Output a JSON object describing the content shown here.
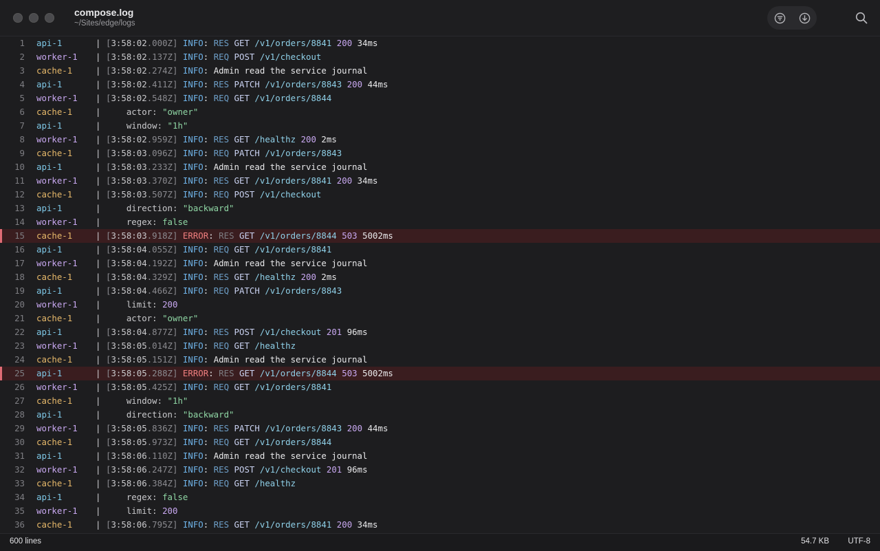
{
  "window": {
    "title": "compose.log",
    "path": "~/Sites/edge/logs"
  },
  "toolbar": {
    "icons": [
      "filter-icon",
      "download-icon",
      "search-icon"
    ]
  },
  "colors": {
    "background": "#1d1d1f",
    "error_row": "#3a1d1f",
    "api": "#7ec7e6",
    "worker": "#c8a8f0",
    "cache": "#e6b86a",
    "info": "#6fb3e8",
    "error": "#f07f7f"
  },
  "log_lines": [
    {
      "n": "1",
      "service": "api-1",
      "ts_prefix": "3:58:02",
      "ts_suffix": ".000Z",
      "level": "INFO",
      "dir": "RES",
      "method": "GET",
      "path": "/v1/orders/8841",
      "status": "200",
      "dur": "34ms"
    },
    {
      "n": "2",
      "service": "worker-1",
      "ts_prefix": "3:58:02",
      "ts_suffix": ".137Z",
      "level": "INFO",
      "dir": "REQ",
      "method": "POST",
      "path": "/v1/checkout"
    },
    {
      "n": "3",
      "service": "cache-1",
      "ts_prefix": "3:58:02",
      "ts_suffix": ".274Z",
      "level": "INFO",
      "text": "Admin read the service journal"
    },
    {
      "n": "4",
      "service": "api-1",
      "ts_prefix": "3:58:02",
      "ts_suffix": ".411Z",
      "level": "INFO",
      "dir": "RES",
      "method": "PATCH",
      "path": "/v1/orders/8843",
      "status": "200",
      "dur": "44ms"
    },
    {
      "n": "5",
      "service": "worker-1",
      "ts_prefix": "3:58:02",
      "ts_suffix": ".548Z",
      "level": "INFO",
      "dir": "REQ",
      "method": "GET",
      "path": "/v1/orders/8844"
    },
    {
      "n": "6",
      "service": "cache-1",
      "key": "actor",
      "value": "\"owner\"",
      "vtype": "str"
    },
    {
      "n": "7",
      "service": "api-1",
      "key": "window",
      "value": "\"1h\"",
      "vtype": "str"
    },
    {
      "n": "8",
      "service": "worker-1",
      "ts_prefix": "3:58:02",
      "ts_suffix": ".959Z",
      "level": "INFO",
      "dir": "RES",
      "method": "GET",
      "path": "/healthz",
      "status": "200",
      "dur": "2ms"
    },
    {
      "n": "9",
      "service": "cache-1",
      "ts_prefix": "3:58:03",
      "ts_suffix": ".096Z",
      "level": "INFO",
      "dir": "REQ",
      "method": "PATCH",
      "path": "/v1/orders/8843"
    },
    {
      "n": "10",
      "service": "api-1",
      "ts_prefix": "3:58:03",
      "ts_suffix": ".233Z",
      "level": "INFO",
      "text": "Admin read the service journal"
    },
    {
      "n": "11",
      "service": "worker-1",
      "ts_prefix": "3:58:03",
      "ts_suffix": ".370Z",
      "level": "INFO",
      "dir": "RES",
      "method": "GET",
      "path": "/v1/orders/8841",
      "status": "200",
      "dur": "34ms"
    },
    {
      "n": "12",
      "service": "cache-1",
      "ts_prefix": "3:58:03",
      "ts_suffix": ".507Z",
      "level": "INFO",
      "dir": "REQ",
      "method": "POST",
      "path": "/v1/checkout"
    },
    {
      "n": "13",
      "service": "api-1",
      "key": "direction",
      "value": "\"backward\"",
      "vtype": "str"
    },
    {
      "n": "14",
      "service": "worker-1",
      "key": "regex",
      "value": "false",
      "vtype": "bool"
    },
    {
      "n": "15",
      "service": "cache-1",
      "ts_prefix": "3:58:03",
      "ts_suffix": ".918Z",
      "level": "ERROR",
      "dir": "RES",
      "method": "GET",
      "path": "/v1/orders/8844",
      "status": "503",
      "dur": "5002ms"
    },
    {
      "n": "16",
      "service": "api-1",
      "ts_prefix": "3:58:04",
      "ts_suffix": ".055Z",
      "level": "INFO",
      "dir": "REQ",
      "method": "GET",
      "path": "/v1/orders/8841"
    },
    {
      "n": "17",
      "service": "worker-1",
      "ts_prefix": "3:58:04",
      "ts_suffix": ".192Z",
      "level": "INFO",
      "text": "Admin read the service journal"
    },
    {
      "n": "18",
      "service": "cache-1",
      "ts_prefix": "3:58:04",
      "ts_suffix": ".329Z",
      "level": "INFO",
      "dir": "RES",
      "method": "GET",
      "path": "/healthz",
      "status": "200",
      "dur": "2ms"
    },
    {
      "n": "19",
      "service": "api-1",
      "ts_prefix": "3:58:04",
      "ts_suffix": ".466Z",
      "level": "INFO",
      "dir": "REQ",
      "method": "PATCH",
      "path": "/v1/orders/8843"
    },
    {
      "n": "20",
      "service": "worker-1",
      "key": "limit",
      "value": "200",
      "vtype": "num"
    },
    {
      "n": "21",
      "service": "cache-1",
      "key": "actor",
      "value": "\"owner\"",
      "vtype": "str"
    },
    {
      "n": "22",
      "service": "api-1",
      "ts_prefix": "3:58:04",
      "ts_suffix": ".877Z",
      "level": "INFO",
      "dir": "RES",
      "method": "POST",
      "path": "/v1/checkout",
      "status": "201",
      "dur": "96ms"
    },
    {
      "n": "23",
      "service": "worker-1",
      "ts_prefix": "3:58:05",
      "ts_suffix": ".014Z",
      "level": "INFO",
      "dir": "REQ",
      "method": "GET",
      "path": "/healthz"
    },
    {
      "n": "24",
      "service": "cache-1",
      "ts_prefix": "3:58:05",
      "ts_suffix": ".151Z",
      "level": "INFO",
      "text": "Admin read the service journal"
    },
    {
      "n": "25",
      "service": "api-1",
      "ts_prefix": "3:58:05",
      "ts_suffix": ".288Z",
      "level": "ERROR",
      "dir": "RES",
      "method": "GET",
      "path": "/v1/orders/8844",
      "status": "503",
      "dur": "5002ms"
    },
    {
      "n": "26",
      "service": "worker-1",
      "ts_prefix": "3:58:05",
      "ts_suffix": ".425Z",
      "level": "INFO",
      "dir": "REQ",
      "method": "GET",
      "path": "/v1/orders/8841"
    },
    {
      "n": "27",
      "service": "cache-1",
      "key": "window",
      "value": "\"1h\"",
      "vtype": "str"
    },
    {
      "n": "28",
      "service": "api-1",
      "key": "direction",
      "value": "\"backward\"",
      "vtype": "str"
    },
    {
      "n": "29",
      "service": "worker-1",
      "ts_prefix": "3:58:05",
      "ts_suffix": ".836Z",
      "level": "INFO",
      "dir": "RES",
      "method": "PATCH",
      "path": "/v1/orders/8843",
      "status": "200",
      "dur": "44ms"
    },
    {
      "n": "30",
      "service": "cache-1",
      "ts_prefix": "3:58:05",
      "ts_suffix": ".973Z",
      "level": "INFO",
      "dir": "REQ",
      "method": "GET",
      "path": "/v1/orders/8844"
    },
    {
      "n": "31",
      "service": "api-1",
      "ts_prefix": "3:58:06",
      "ts_suffix": ".110Z",
      "level": "INFO",
      "text": "Admin read the service journal"
    },
    {
      "n": "32",
      "service": "worker-1",
      "ts_prefix": "3:58:06",
      "ts_suffix": ".247Z",
      "level": "INFO",
      "dir": "RES",
      "method": "POST",
      "path": "/v1/checkout",
      "status": "201",
      "dur": "96ms"
    },
    {
      "n": "33",
      "service": "cache-1",
      "ts_prefix": "3:58:06",
      "ts_suffix": ".384Z",
      "level": "INFO",
      "dir": "REQ",
      "method": "GET",
      "path": "/healthz"
    },
    {
      "n": "34",
      "service": "api-1",
      "key": "regex",
      "value": "false",
      "vtype": "bool"
    },
    {
      "n": "35",
      "service": "worker-1",
      "key": "limit",
      "value": "200",
      "vtype": "num"
    },
    {
      "n": "36",
      "service": "cache-1",
      "ts_prefix": "3:58:06",
      "ts_suffix": ".795Z",
      "level": "INFO",
      "dir": "RES",
      "method": "GET",
      "path": "/v1/orders/8841",
      "status": "200",
      "dur": "34ms"
    }
  ],
  "statusbar": {
    "line_count": "600 lines",
    "file_size": "54.7 KB",
    "encoding": "UTF-8"
  }
}
